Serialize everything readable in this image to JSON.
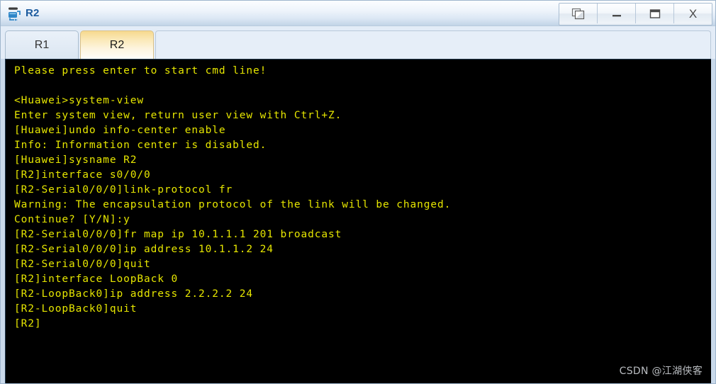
{
  "window": {
    "title": "R2",
    "icon": "router-icon",
    "controls": [
      {
        "name": "restore-windows-button",
        "icon": "cascade-windows-icon",
        "label": ""
      },
      {
        "name": "minimize-button",
        "icon": "minimize-icon",
        "label": ""
      },
      {
        "name": "maximize-button",
        "icon": "maximize-icon",
        "label": ""
      },
      {
        "name": "close-button",
        "icon": "close-icon",
        "label": "X"
      }
    ]
  },
  "tabs": [
    {
      "label": "R1",
      "active": false
    },
    {
      "label": "R2",
      "active": true
    }
  ],
  "terminal": {
    "background_color": "#000000",
    "text_color": "#e6e600",
    "lines": [
      "Please press enter to start cmd line!",
      "",
      "<Huawei>system-view",
      "Enter system view, return user view with Ctrl+Z.",
      "[Huawei]undo info-center enable",
      "Info: Information center is disabled.",
      "[Huawei]sysname R2",
      "[R2]interface s0/0/0",
      "[R2-Serial0/0/0]link-protocol fr",
      "Warning: The encapsulation protocol of the link will be changed.",
      "Continue? [Y/N]:y",
      "[R2-Serial0/0/0]fr map ip 10.1.1.1 201 broadcast",
      "[R2-Serial0/0/0]ip address 10.1.1.2 24",
      "[R2-Serial0/0/0]quit",
      "[R2]interface LoopBack 0",
      "[R2-LoopBack0]ip address 2.2.2.2 24",
      "[R2-LoopBack0]quit",
      "[R2]"
    ]
  },
  "watermark": {
    "text": "CSDN @江湖侠客"
  }
}
